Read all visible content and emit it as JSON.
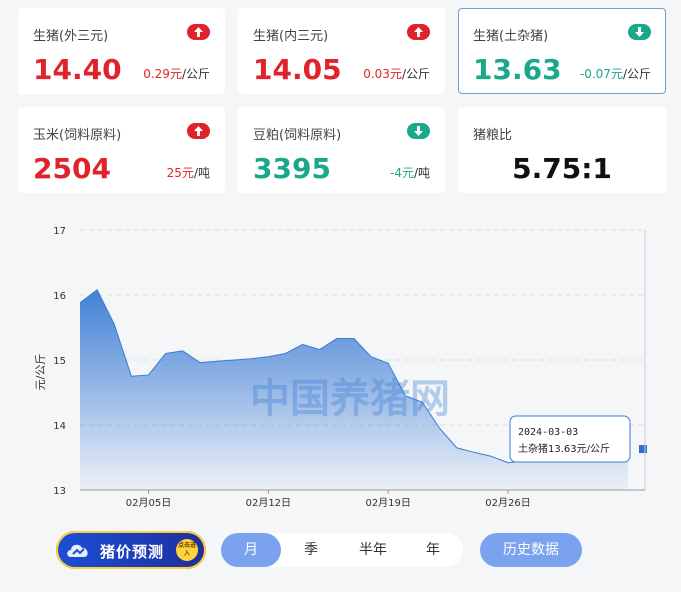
{
  "cards": [
    {
      "label": "生猪(外三元)",
      "value": "14.40",
      "change": "0.29元",
      "unit": "/公斤",
      "direction": "up"
    },
    {
      "label": "生猪(内三元)",
      "value": "14.05",
      "change": "0.03元",
      "unit": "/公斤",
      "direction": "up"
    },
    {
      "label": "生猪(土杂猪)",
      "value": "13.63",
      "change": "-0.07元",
      "unit": "/公斤",
      "direction": "down"
    },
    {
      "label": "玉米(饲料原料)",
      "value": "2504",
      "change": "25元",
      "unit": "/吨",
      "direction": "up"
    },
    {
      "label": "豆粕(饲料原料)",
      "value": "3395",
      "change": "-4元",
      "unit": "/吨",
      "direction": "down"
    },
    {
      "label": "猪粮比",
      "value": "5.75:1"
    }
  ],
  "colors": {
    "up": "#e0232b",
    "down": "#1aa88b",
    "accent": "#7aa2ee",
    "line": "#3a7bd5"
  },
  "icons": {
    "up": "arrow-up-icon",
    "down": "arrow-down-icon"
  },
  "watermark": "中国养猪网",
  "tooltip": {
    "date": "2024-03-03",
    "text": "土杂猪13.63元/公斤"
  },
  "chart_data": {
    "type": "area",
    "ylabel": "元/公斤",
    "ylim": [
      13,
      17
    ],
    "yticks": [
      13,
      14,
      15,
      16,
      17
    ],
    "xticks": [
      {
        "label": "02月05日",
        "day": 5
      },
      {
        "label": "02月12日",
        "day": 12
      },
      {
        "label": "02月19日",
        "day": 19
      },
      {
        "label": "02月26日",
        "day": 26
      }
    ],
    "xlim": [
      1,
      34
    ],
    "grid": true,
    "series": [
      {
        "x": [
          1,
          2,
          3,
          4,
          5,
          6,
          7,
          8,
          9,
          10,
          11,
          12,
          13,
          14,
          15,
          16,
          17,
          18,
          19,
          20,
          21,
          22,
          23,
          24,
          25,
          26,
          27,
          28,
          29,
          30,
          31,
          32,
          33
        ],
        "values": [
          15.88,
          16.08,
          15.55,
          14.75,
          14.77,
          15.1,
          15.14,
          14.96,
          14.98,
          15.0,
          15.02,
          15.05,
          15.1,
          15.24,
          15.16,
          15.33,
          15.33,
          15.05,
          14.95,
          14.45,
          14.35,
          13.95,
          13.65,
          13.58,
          13.52,
          13.42,
          13.45,
          13.52,
          13.6,
          13.62,
          13.64,
          13.63,
          13.63
        ]
      }
    ]
  },
  "bottom": {
    "predict_label": "猪价预测",
    "badge_text": "点击进入",
    "tabs": [
      "月",
      "季",
      "半年",
      "年"
    ],
    "active_tab": "月",
    "history_label": "历史数据"
  }
}
